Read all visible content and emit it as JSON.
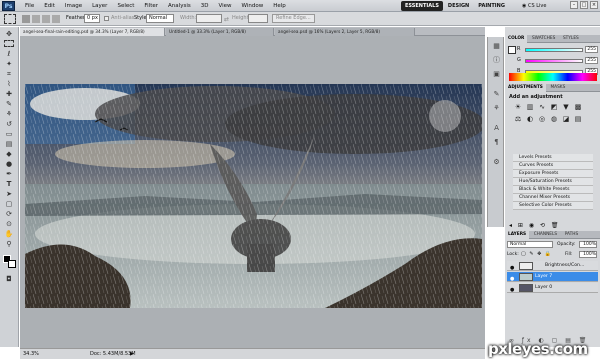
{
  "menubar": {
    "logo": "Ps",
    "menus": [
      "File",
      "Edit",
      "Image",
      "Layer",
      "Select",
      "Filter",
      "Analysis",
      "3D",
      "View",
      "Window",
      "Help"
    ],
    "workspaces": [
      "ESSENTIALS",
      "DESIGN",
      "PAINTING"
    ],
    "cs_live": "CS Live"
  },
  "options": {
    "feather_label": "Feather:",
    "feather_value": "0 px",
    "antialias_label": "Anti-alias",
    "style_label": "Style:",
    "style_value": "Normal",
    "width_label": "Width:",
    "height_label": "Height:",
    "refine_label": "Refine Edge..."
  },
  "doc_tabs": [
    "angel-sea-final-rain-editing.psd @ 34.3% (Layer 7, RGB/8)",
    "Untitled-1 @ 33.3% (Layer 1, RGB/8)",
    "angel-sea.psd @ 16% (Layers 2, Layer 5, RGB/8)"
  ],
  "status": {
    "zoom": "34.3%",
    "doc": "Doc: 5.43M/8.53M"
  },
  "color_panel": {
    "tabs": [
      "COLOR",
      "SWATCHES",
      "STYLES"
    ],
    "r_label": "R",
    "g_label": "G",
    "b_label": "B",
    "r_value": "255",
    "g_value": "255",
    "b_value": "255"
  },
  "adjustments": {
    "tabs": [
      "ADJUSTMENTS",
      "MASKS"
    ],
    "heading": "Add an adjustment",
    "presets": [
      "Levels Presets",
      "Curves Presets",
      "Exposure Presets",
      "Hue/Saturation Presets",
      "Black & White Presets",
      "Channel Mixer Presets",
      "Selective Color Presets"
    ]
  },
  "layers_panel": {
    "tabs": [
      "LAYERS",
      "CHANNELS",
      "PATHS"
    ],
    "blend_mode": "Normal",
    "opacity_label": "Opacity:",
    "opacity_value": "100%",
    "lock_label": "Lock:",
    "fill_label": "Fill:",
    "fill_value": "100%",
    "layers": [
      {
        "name": "Brightness/Con...",
        "selected": false
      },
      {
        "name": "Layer 7",
        "selected": true
      },
      {
        "name": "Layer 0",
        "selected": false
      }
    ]
  },
  "watermark": "pxleyes.com",
  "colors": {
    "accent": "#3b8ce8",
    "toolbar": "#cfd2d6",
    "canvas_bg": "#acb0b4"
  }
}
